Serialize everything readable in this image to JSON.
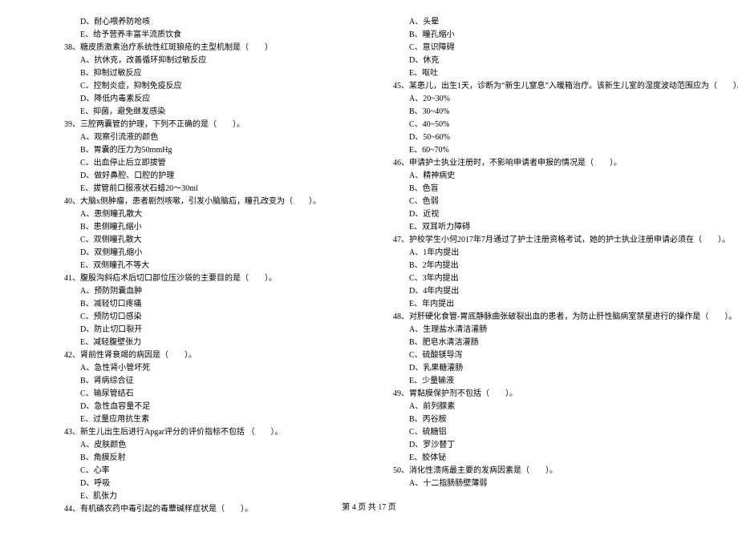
{
  "left": {
    "pre_options": [
      "D、耐心喂养防呛咳",
      "E、给予营养丰富半流质饮食"
    ],
    "questions": [
      {
        "num": "38、",
        "text": "糖皮质激素治疗系统性红斑狼疮的主型机制是（　　）",
        "options": [
          "A、抗休克，改善循环抑制过敏反应",
          "B、抑制过敏反应",
          "C、控制炎症，抑制免疫反应",
          "D、降低内毒素反应",
          "E、抑菌，避免继发感染"
        ]
      },
      {
        "num": "39、",
        "text": "三腔两囊管的护理，下列不正确的是（　　）。",
        "options": [
          "A、观察引流液的颜色",
          "B、胃囊的压力为50mmHg",
          "C、出血停止后立即拔管",
          "D、做好鼻腔、口腔的护理",
          "E、拔管前口服液状石蜡20～30ml"
        ]
      },
      {
        "num": "40、",
        "text": "大脑x侧肿瘤，患者剧烈咳嗽，引发小脑脑疝，瞳孔改变为（　　）。",
        "options": [
          "A、患侧瞳孔散大",
          "B、患侧瞳孔缩小",
          "C、双侧瞳孔散大",
          "D、双侧瞳孔缩小",
          "E、双侧瞳孔不等大"
        ]
      },
      {
        "num": "41、",
        "text": "腹股沟斜疝术后切口部位压沙袋的主要目的是（　　）。",
        "options": [
          "A、预防阴囊血肿",
          "B、减轻切口疼痛",
          "C、预防切口感染",
          "D、防止切口裂开",
          "E、减轻腹壁张力"
        ]
      },
      {
        "num": "42、",
        "text": "肾前性肾衰竭的病因是（　　）。",
        "options": [
          "A、急性肾小管坏死",
          "B、肾病综合征",
          "C、输尿管结石",
          "D、急性血容量不足",
          "E、过量应用抗生素"
        ]
      },
      {
        "num": "43、",
        "text": "新生儿出生后进行Apgar评分的评价指标不包括 （　　）。",
        "options": [
          "A、皮肤颜色",
          "B、角膜反射",
          "C、心率",
          "D、呼吸",
          "E、肌张力"
        ]
      },
      {
        "num": "44、",
        "text": "有机磷农药中毒引起的毒蕈碱样症状是（　　）。",
        "options": []
      }
    ]
  },
  "right": {
    "pre_options": [
      "A、头晕",
      "B、瞳孔缩小",
      "C、意识障碍",
      "D、休克",
      "E、呕吐"
    ],
    "questions": [
      {
        "num": "45、",
        "text": "某患儿，出生1天，诊断为“新生儿窒息”入暖箱治疗。该新生儿室的湿度波动范围应为（　　）。",
        "options": [
          "A、20~30%",
          "B、30~40%",
          "C、40~50%",
          "D、50~60%",
          "E、60~70%"
        ]
      },
      {
        "num": "46、",
        "text": "申请护士执业注册时，不影响申请者申报的情况是（　　）。",
        "options": [
          "A、精神病史",
          "B、色盲",
          "C、色弱",
          "D、近视",
          "E、双耳听力障碍"
        ]
      },
      {
        "num": "47、",
        "text": "护校学生小何2017年7月通过了护士注册资格考试，她的护士执业注册申请必须在（　　）。",
        "options": [
          "A、1年内提出",
          "B、2年内提出",
          "C、3年内提出",
          "D、4年内提出",
          "E、年内提出"
        ]
      },
      {
        "num": "48、",
        "text": "对肝硬化食管-胃底静脉曲张破裂出血的患者，为防止肝性脑病室禁星进行的操作是（　　）。",
        "options": [
          "A、生理盐水清洁灌肠",
          "B、肥皂水清洁灌肠",
          "C、硫酸镁导泻",
          "D、乳果糖灌肠",
          "E、少量输液"
        ]
      },
      {
        "num": "49、",
        "text": "胃黏膜保护剂不包括（　　）。",
        "options": [
          "A、前列腺素",
          "B、丙谷胺",
          "C、硫糖铝",
          "D、罗沙替丁",
          "E、胶体铋"
        ]
      },
      {
        "num": "50、",
        "text": "消化性溃疡最主要的发病因素是（　　）。",
        "options": [
          "A、十二指肠肠壁薄弱"
        ]
      }
    ]
  },
  "footer": {
    "page_label": "第 4 页 共 17 页"
  }
}
